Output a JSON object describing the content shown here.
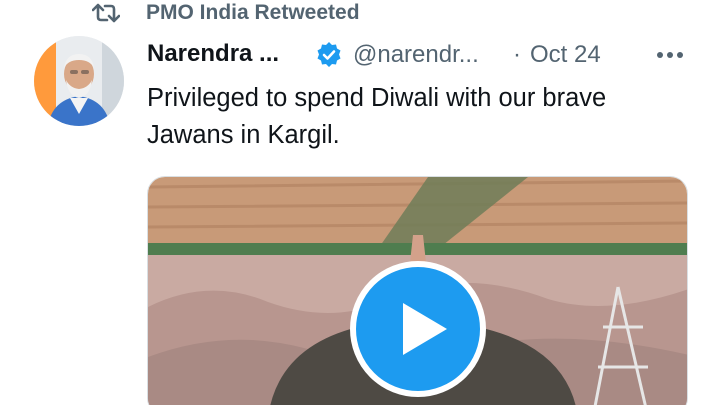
{
  "retweet": {
    "label": "PMO India Retweeted",
    "icon": "retweet-icon"
  },
  "tweet": {
    "display_name": "Narendra ...",
    "handle": "@narendr...",
    "separator": "·",
    "time": "Oct 24",
    "text": "Privileged to spend Diwali with our brave Jawans in Kargil.",
    "verified_icon": "verified-badge-icon",
    "more_icon": "more-options-icon"
  },
  "media": {
    "type": "video",
    "play_icon": "play-icon"
  },
  "colors": {
    "accent": "#1d9bf0",
    "secondary_text": "#536471",
    "primary_text": "#0f1419"
  }
}
